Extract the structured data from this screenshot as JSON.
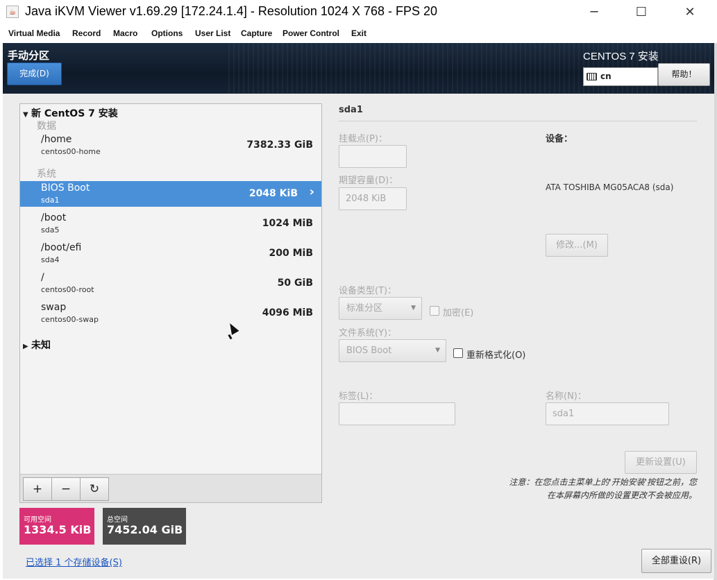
{
  "window": {
    "title": "Java iKVM Viewer v1.69.29 [172.24.1.4]  - Resolution 1024 X 768 - FPS 20",
    "minimize": "─",
    "maximize": "☐",
    "close": "✕"
  },
  "menu": [
    "Virtual Media",
    "Record",
    "Macro",
    "Options",
    "User List",
    "Capture",
    "Power Control",
    "Exit"
  ],
  "header": {
    "spoke_title": "手动分区",
    "done_label": "完成(D)",
    "product": "CENTOS 7 安装",
    "keyboard_layout": "cn",
    "help_label": "帮助！"
  },
  "tree": {
    "root_label": "新 CentOS 7 安装",
    "groups": [
      {
        "label": "数据",
        "items": [
          {
            "name": "/home",
            "device": "centos00-home",
            "size": "7382.33 GiB"
          }
        ]
      },
      {
        "label": "系统",
        "items": [
          {
            "name": "BIOS Boot",
            "device": "sda1",
            "size": "2048 KiB",
            "selected": true
          },
          {
            "name": "/boot",
            "device": "sda5",
            "size": "1024 MiB"
          },
          {
            "name": "/boot/efi",
            "device": "sda4",
            "size": "200 MiB"
          },
          {
            "name": "/",
            "device": "centos00-root",
            "size": "50 GiB"
          },
          {
            "name": "swap",
            "device": "centos00-swap",
            "size": "4096 MiB"
          }
        ]
      }
    ],
    "unknown_label": "未知",
    "toolbar": {
      "add": "+",
      "remove": "−",
      "refresh": "↻"
    }
  },
  "space": {
    "available_label": "可用空间",
    "available_value": "1334.5 KiB",
    "total_label": "总空间",
    "total_value": "7452.04 GiB",
    "available_color": "#d93175",
    "total_color": "#4a4a4a"
  },
  "storage_link": "已选择 1 个存储设备(S)",
  "detail": {
    "title": "sda1",
    "mount_label": "挂载点(P)：",
    "mount_value": "",
    "capacity_label": "期望容量(D)：",
    "capacity_value": "2048 KiB",
    "device_label": "设备：",
    "device_value": "ATA TOSHIBA MG05ACA8 (sda)",
    "modify_label": "修改...(M)",
    "device_type_label": "设备类型(T)：",
    "device_type_value": "标准分区",
    "encrypt_label": "加密(E)",
    "fs_label": "文件系统(Y)：",
    "fs_value": "BIOS Boot",
    "reformat_label": "重新格式化(O)",
    "tag_label": "标签(L)：",
    "tag_value": "",
    "name_label": "名称(N)：",
    "name_value": "sda1",
    "update_label": "更新设置(U)",
    "note_line1": "注意：在您点击主菜单上的'开始安装'按钮之前，您",
    "note_line2": "在本屏幕内所做的设置更改不会被应用。",
    "reset_label": "全部重设(R)"
  },
  "colors": {
    "selection": "#4a90d9",
    "header_bg": "#142234"
  }
}
